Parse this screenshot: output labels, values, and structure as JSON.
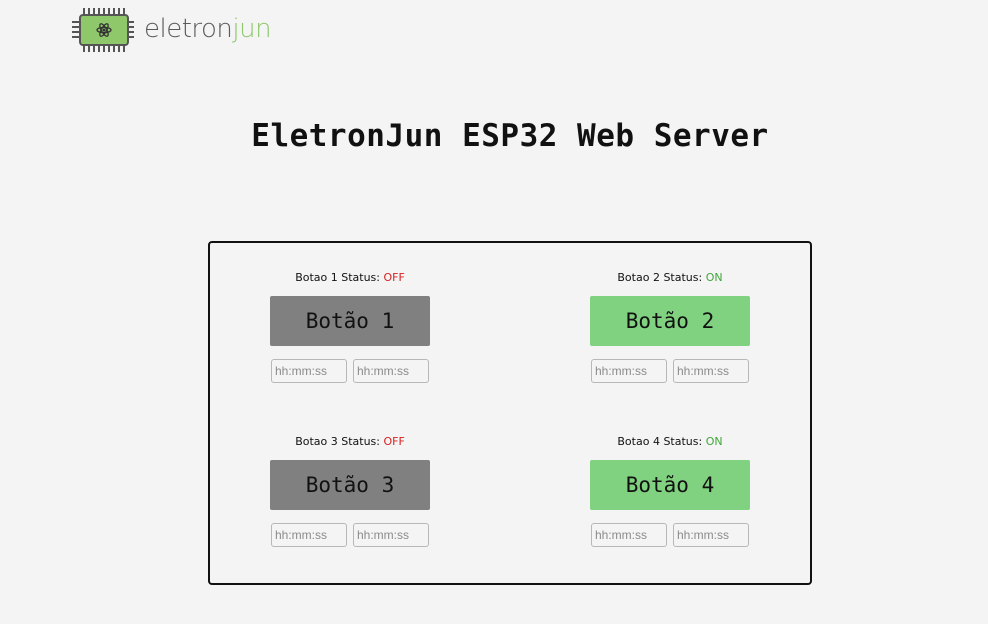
{
  "logo": {
    "text_part1": "eletron",
    "text_part2": "jun",
    "brand_color": "#8fc76b"
  },
  "page": {
    "title": "EletronJun ESP32 Web Server"
  },
  "buttons": [
    {
      "status_label": "Botao 1 Status: ",
      "status_value": "OFF",
      "button_label": "Botão 1",
      "state": "off",
      "time_on_placeholder": "hh:mm:ss",
      "time_off_placeholder": "hh:mm:ss"
    },
    {
      "status_label": "Botao 2 Status: ",
      "status_value": "ON",
      "button_label": "Botão 2",
      "state": "on",
      "time_on_placeholder": "hh:mm:ss",
      "time_off_placeholder": "hh:mm:ss"
    },
    {
      "status_label": "Botao 3 Status: ",
      "status_value": "OFF",
      "button_label": "Botão 3",
      "state": "off",
      "time_on_placeholder": "hh:mm:ss",
      "time_off_placeholder": "hh:mm:ss"
    },
    {
      "status_label": "Botao 4 Status: ",
      "status_value": "ON",
      "button_label": "Botão 4",
      "state": "on",
      "time_on_placeholder": "hh:mm:ss",
      "time_off_placeholder": "hh:mm:ss"
    }
  ],
  "colors": {
    "off_button": "#808080",
    "on_button": "#80d280",
    "off_text": "#d61f1f",
    "on_text": "#3fa63a"
  }
}
